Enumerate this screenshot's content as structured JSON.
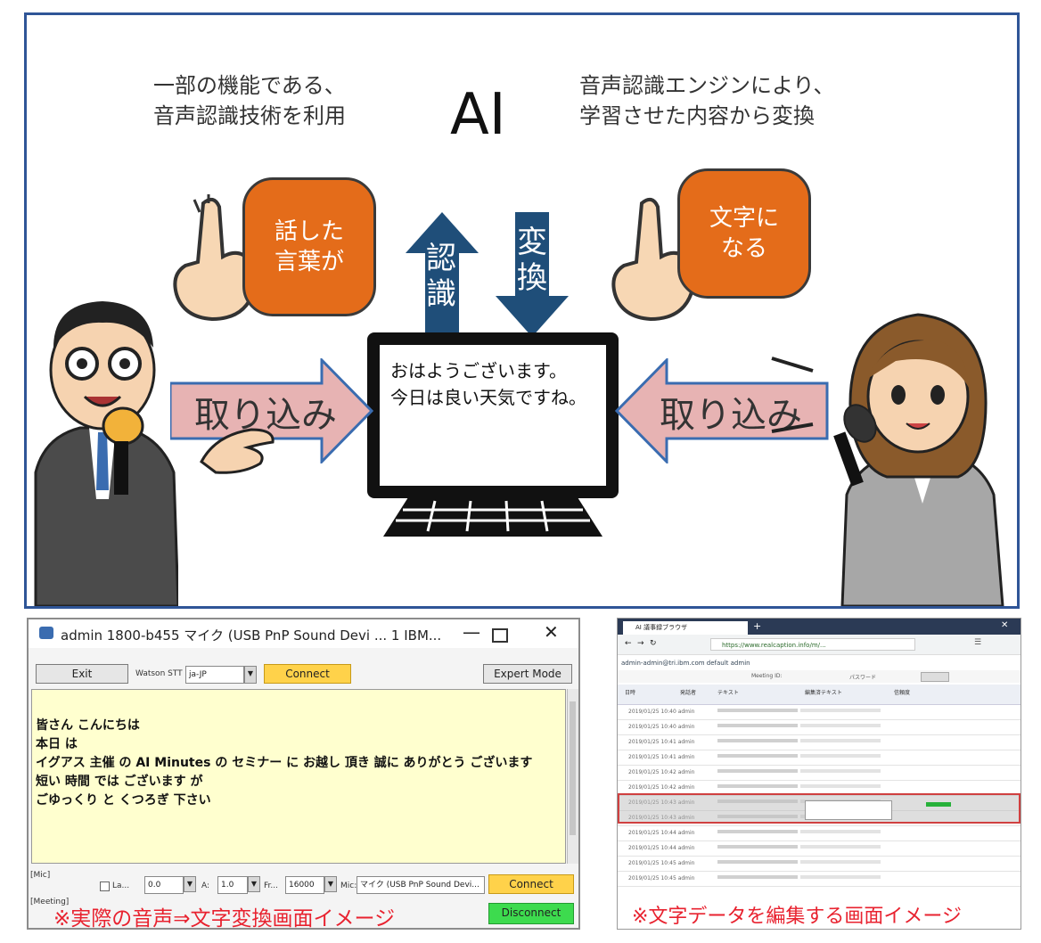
{
  "diagram": {
    "caption_left": "一部の機能である、\n音声認識技術を利用",
    "caption_right": "音声認識エンジンにより、\n学習させた内容から変換",
    "ai_label": "AI",
    "bubble_left": "話した\n言葉が",
    "bubble_right": "文字に\nなる",
    "arrow_up_text": "認識",
    "arrow_down_text": "変換",
    "arrow_left_label": "取り込み",
    "arrow_right_label": "取り込み",
    "screen_text": "おはようございます。\n今日は良い天気ですね。",
    "colors": {
      "frame": "#2f5597",
      "bubble": "#e46c1a",
      "pink_arrow": "#e7b3b3",
      "blue_arrow": "#1f4e79"
    }
  },
  "stt_window": {
    "title": "admin 1800-b455 マイク (USB PnP Sound Devi ... 1 IBM...",
    "exit_button": "Exit",
    "engine_label": "Watson STT",
    "engine_value": "ja-JP",
    "connect_button": "Connect",
    "expert_button": "Expert Mode",
    "transcript": [
      "皆さん こんにちは",
      "本日 は",
      "イグアス 主催 の AI Minutes の セミナー に お越し 頂き 誠に ありがとう ございます",
      "短い 時間 では ございます が",
      "ごゆっくり と くつろぎ 下さい"
    ],
    "status_mic": "[Mic]",
    "status_meeting": "[Meeting]",
    "opt_lang_label": "La...",
    "opt_lang_value": "0.0",
    "opt_a_label": "A:",
    "opt_a_value": "1.0",
    "opt_fr_label": "Fr...",
    "opt_fr_value": "16000",
    "opt_mic_label": "Mic:",
    "opt_mic_value": "マイク (USB PnP Sound Devi...",
    "connect2_button": "Connect",
    "disconnect_button": "Disconnect",
    "caption": "※実際の音声⇒文字変換画面イメージ"
  },
  "browser_window": {
    "tab_title": "AI 議事録ブラウザ",
    "url": "https://www.realcaption.info/m/...",
    "user_line": "admin-admin@tri.ibm.com default admin",
    "meeting_label": "Meeting ID:",
    "password_label": "パスワード",
    "header_cols": [
      "日時",
      "発話者",
      "テキスト",
      "編集済テキスト",
      "信頼度"
    ],
    "rows": [
      "2019/01/25 10:40 admin",
      "2019/01/25 10:40 admin",
      "2019/01/25 10:41 admin",
      "2019/01/25 10:41 admin",
      "2019/01/25 10:42 admin",
      "2019/01/25 10:42 admin",
      "2019/01/25 10:43 admin",
      "2019/01/25 10:43 admin",
      "2019/01/25 10:44 admin",
      "2019/01/25 10:44 admin",
      "2019/01/25 10:45 admin",
      "2019/01/25 10:45 admin"
    ],
    "caption": "※文字データを編集する画面イメージ"
  }
}
